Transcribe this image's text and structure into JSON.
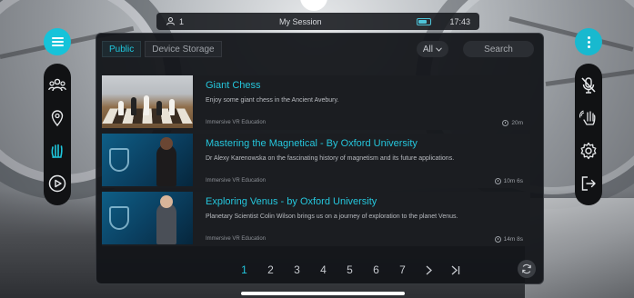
{
  "status_bar": {
    "user_count": "1",
    "session_title": "My Session",
    "time": "17:43"
  },
  "tabs": [
    {
      "label": "Public",
      "active": true
    },
    {
      "label": "Device Storage",
      "active": false
    }
  ],
  "filter": {
    "label": "All"
  },
  "search": {
    "placeholder": "Search"
  },
  "experiences": [
    {
      "title": "Giant Chess",
      "description": "Enjoy some giant chess in the Ancient Avebury.",
      "author": "Immersive VR Education",
      "duration": "20m",
      "thumbnail": "chess"
    },
    {
      "title": "Mastering the Magnetical - By Oxford University",
      "description": "Dr Alexy Karenowska on the fascinating history of magnetism and its future applications.",
      "author": "Immersive VR Education",
      "duration": "10m 6s",
      "thumbnail": "oxford-magnetism"
    },
    {
      "title": "Exploring Venus - by Oxford University",
      "description": "Planetary Scientist Colin Wilson brings us on a journey of exploration to the planet Venus.",
      "author": "Immersive VR Education",
      "duration": "14m 8s",
      "thumbnail": "oxford-venus"
    }
  ],
  "pagination": {
    "pages": [
      "1",
      "2",
      "3",
      "4",
      "5",
      "6",
      "7"
    ],
    "current": "1"
  },
  "icons": {
    "left_toolbar": [
      "users-icon",
      "location-pin-icon",
      "hand-wave-icon",
      "play-icon"
    ],
    "right_toolbar": [
      "microphone-muted-icon",
      "raise-hand-icon",
      "gear-icon",
      "exit-icon"
    ]
  },
  "colors": {
    "accent": "#20c7dd",
    "panel": "#121418",
    "toolbar": "#111214"
  }
}
